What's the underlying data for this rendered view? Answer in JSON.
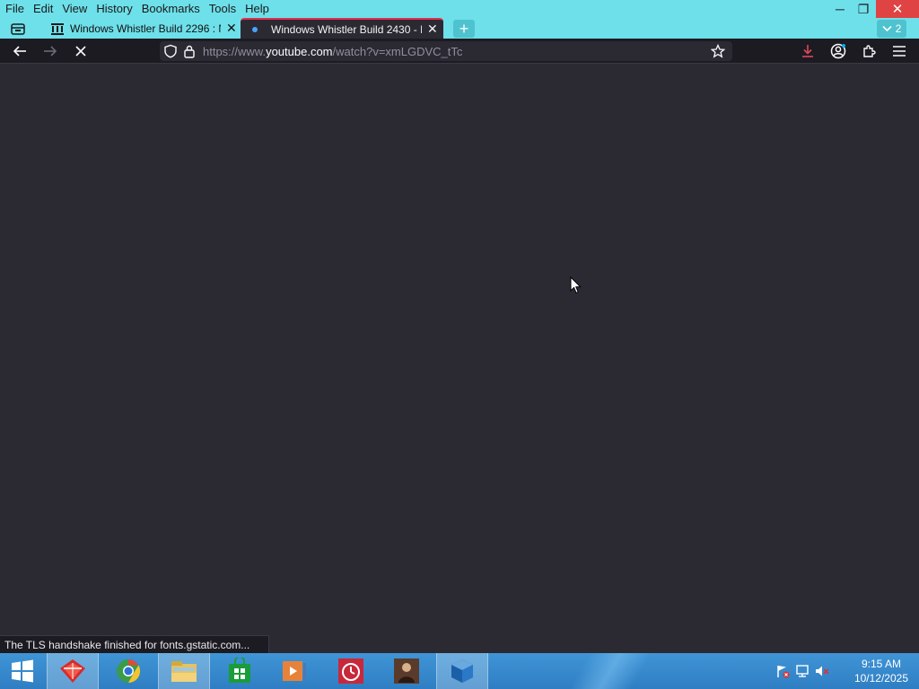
{
  "menu": [
    "File",
    "Edit",
    "View",
    "History",
    "Bookmarks",
    "Tools",
    "Help"
  ],
  "window_controls": {
    "minimize": "─",
    "restore": "❐",
    "close": "✕"
  },
  "tabs": [
    {
      "label": "Windows Whistler Build 2296 : N",
      "close": "✕",
      "active": false
    },
    {
      "label": "Windows Whistler Build 2430 - I",
      "close": "✕",
      "active": true
    }
  ],
  "new_tab_label": "+",
  "tab_list_count": "2",
  "address": {
    "scheme": "https://www.",
    "host": "youtube.com",
    "path": "/watch?v=xmLGDVC_tTc"
  },
  "status_text": "The TLS handshake finished for fonts.gstatic.com...",
  "taskbar": {
    "apps": [
      "start-icon",
      "gateway-app-icon",
      "chrome-icon",
      "file-explorer-icon",
      "store-icon",
      "media-player-icon",
      "alarm-clock-icon",
      "profile-app-icon",
      "virtualbox-icon"
    ]
  },
  "clock": {
    "time": "9:15 AM",
    "date": "10/12/2025"
  },
  "colors": {
    "titlebar": "#6ee0ea",
    "page_bg": "#2b2a33",
    "close_red": "#e04343",
    "taskbar": "#3a8dd3"
  }
}
